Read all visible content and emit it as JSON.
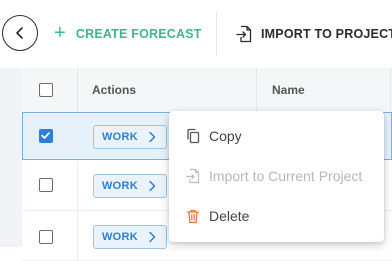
{
  "toolbar": {
    "back_icon": "chevron-left-icon",
    "create_label": "CREATE FORECAST",
    "create_icon": "plus-icon",
    "import_label": "IMPORT TO PROJECT",
    "import_icon": "file-import-icon",
    "accent_color": "#3bb78f"
  },
  "table": {
    "columns": [
      "Actions",
      "Name"
    ],
    "rows": [
      {
        "checked": true,
        "action_label": "WORK"
      },
      {
        "checked": false,
        "action_label": "WORK"
      },
      {
        "checked": false,
        "action_label": "WORK"
      }
    ]
  },
  "context_menu": {
    "items": [
      {
        "label": "Copy",
        "icon": "copy-icon",
        "disabled": false
      },
      {
        "label": "Import to Current Project",
        "icon": "file-import-icon",
        "disabled": true
      },
      {
        "label": "Delete",
        "icon": "trash-icon",
        "disabled": false,
        "icon_color": "#e8743b"
      }
    ]
  }
}
